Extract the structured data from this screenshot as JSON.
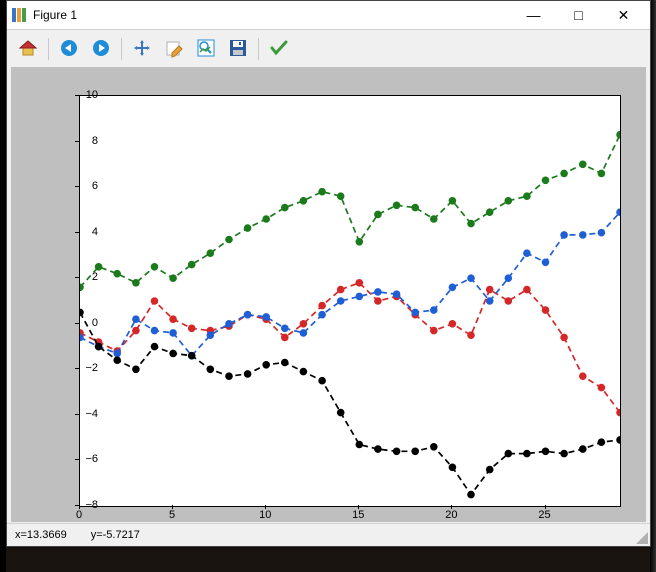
{
  "window": {
    "title": "Figure 1",
    "buttons": {
      "min": "—",
      "max": "□",
      "close": "✕"
    }
  },
  "toolbar": {
    "home": "Home",
    "back": "Back",
    "forward": "Forward",
    "pan": "Pan",
    "edit": "Edit",
    "zoom": "Zoom",
    "save": "Save",
    "check": "Configure"
  },
  "status": {
    "x_label": "x=13.3669",
    "y_label": "y=-5.7217"
  },
  "chart_data": {
    "type": "line",
    "xlabel": "",
    "ylabel": "",
    "xlim": [
      0,
      29
    ],
    "ylim": [
      -8,
      10
    ],
    "xticks": [
      0,
      5,
      10,
      15,
      20,
      25
    ],
    "yticks": [
      -8,
      -6,
      -4,
      -2,
      0,
      2,
      4,
      6,
      8,
      10
    ],
    "x": [
      0,
      1,
      2,
      3,
      4,
      5,
      6,
      7,
      8,
      9,
      10,
      11,
      12,
      13,
      14,
      15,
      16,
      17,
      18,
      19,
      20,
      21,
      22,
      23,
      24,
      25,
      26,
      27,
      28,
      29
    ],
    "series": [
      {
        "name": "green",
        "color": "#1b7a1b",
        "values": [
          1.6,
          2.5,
          2.2,
          1.8,
          2.5,
          2.0,
          2.6,
          3.1,
          3.7,
          4.2,
          4.6,
          5.1,
          5.4,
          5.8,
          5.6,
          3.6,
          4.8,
          5.2,
          5.1,
          4.6,
          5.4,
          4.4,
          4.9,
          5.4,
          5.6,
          6.3,
          6.6,
          7.0,
          6.6,
          8.3
        ]
      },
      {
        "name": "red",
        "color": "#d62728",
        "values": [
          -0.4,
          -0.8,
          -1.2,
          -0.3,
          1.0,
          0.2,
          -0.2,
          -0.3,
          -0.1,
          0.4,
          0.2,
          -0.6,
          0.0,
          0.8,
          1.5,
          1.8,
          1.0,
          1.2,
          0.4,
          -0.3,
          0.0,
          -0.5,
          1.5,
          1.0,
          1.5,
          0.6,
          -0.6,
          -2.3,
          -2.8,
          -3.9
        ]
      },
      {
        "name": "blue",
        "color": "#1f5fd6",
        "values": [
          -0.6,
          -1.0,
          -1.3,
          0.2,
          -0.3,
          -0.4,
          -1.4,
          -0.5,
          0.0,
          0.4,
          0.3,
          -0.2,
          -0.4,
          0.4,
          1.0,
          1.2,
          1.4,
          1.3,
          0.5,
          0.6,
          1.6,
          2.0,
          1.0,
          2.0,
          3.1,
          2.7,
          3.9,
          3.9,
          4.0,
          4.9
        ]
      },
      {
        "name": "black",
        "color": "#000000",
        "values": [
          0.5,
          -1.0,
          -1.6,
          -2.0,
          -1.0,
          -1.3,
          -1.4,
          -2.0,
          -2.3,
          -2.2,
          -1.8,
          -1.7,
          -2.1,
          -2.5,
          -3.9,
          -5.3,
          -5.5,
          -5.6,
          -5.6,
          -5.4,
          -6.3,
          -7.5,
          -6.4,
          -5.7,
          -5.7,
          -5.6,
          -5.7,
          -5.5,
          -5.2,
          -5.1
        ]
      }
    ]
  }
}
